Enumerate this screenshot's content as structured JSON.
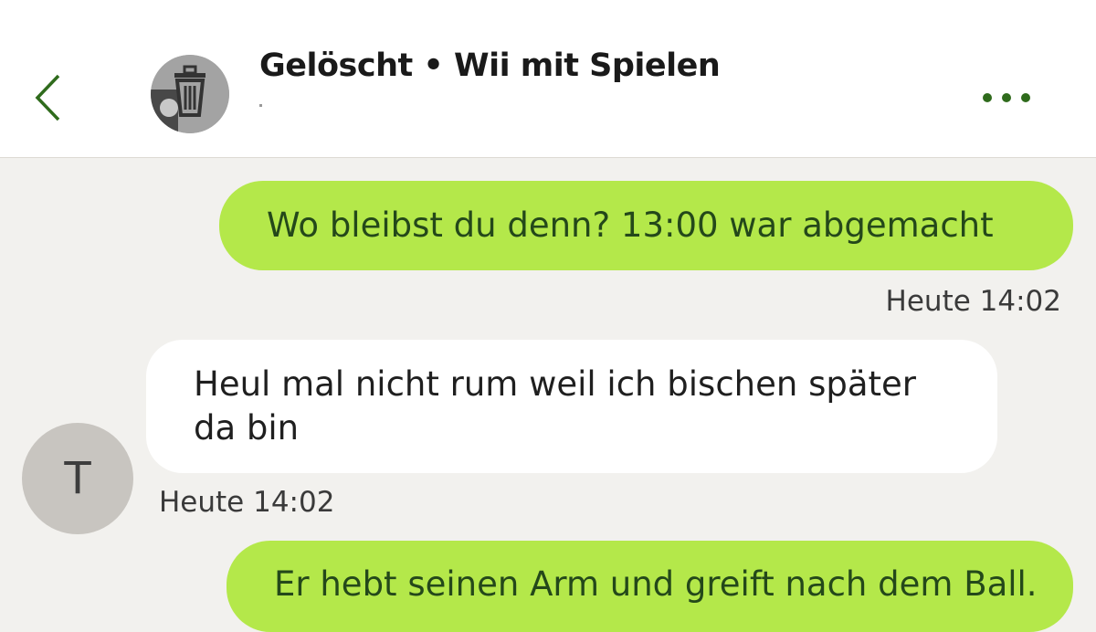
{
  "header": {
    "title": "Gelöscht • Wii mit Spielen",
    "back_icon": "chevron-left-icon",
    "avatar_icon": "trash-icon",
    "more_icon": "more-dots-icon",
    "accent_color": "#2f6b1c"
  },
  "messages": [
    {
      "direction": "outgoing",
      "text": "Wo bleibst du denn? 13:00 war abgemacht",
      "time": "Heute 14:02"
    },
    {
      "direction": "incoming",
      "sender_initial": "T",
      "text": "Heul mal nicht rum weil ich bischen später da bin",
      "time": "Heute 14:02"
    },
    {
      "direction": "outgoing",
      "text": "Er hebt seinen Arm und greift nach dem Ball."
    }
  ],
  "colors": {
    "outgoing_bubble": "#b4e84a",
    "incoming_bubble": "#ffffff",
    "background": "#f2f1ee"
  }
}
